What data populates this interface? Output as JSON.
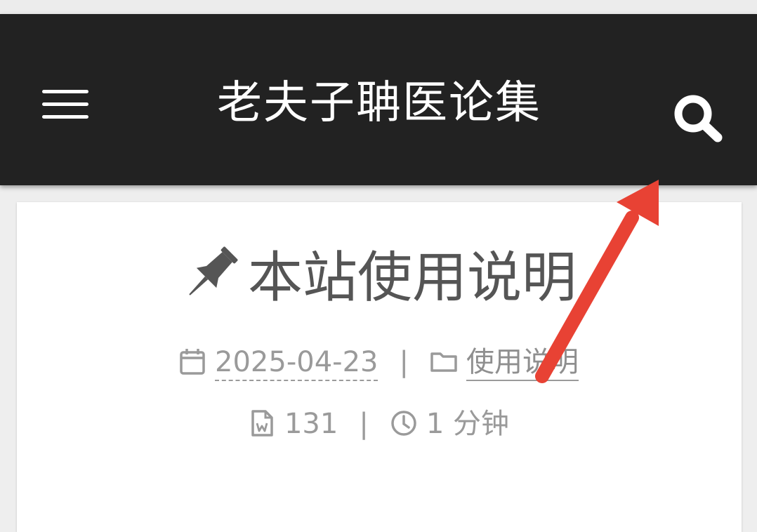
{
  "header": {
    "site_title": "老夫子聃医论集",
    "menu_icon": "hamburger-menu-icon",
    "search_icon": "search-icon",
    "background_color": "#222222"
  },
  "post": {
    "pin_icon": "thumbtack-icon",
    "title": "本站使用说明",
    "date": "2025-04-23",
    "category": "使用说明",
    "word_count": "131",
    "read_time": "1 分钟",
    "separator": "|"
  },
  "annotation": {
    "arrow_color": "#e84234",
    "points_to": "search-icon"
  }
}
